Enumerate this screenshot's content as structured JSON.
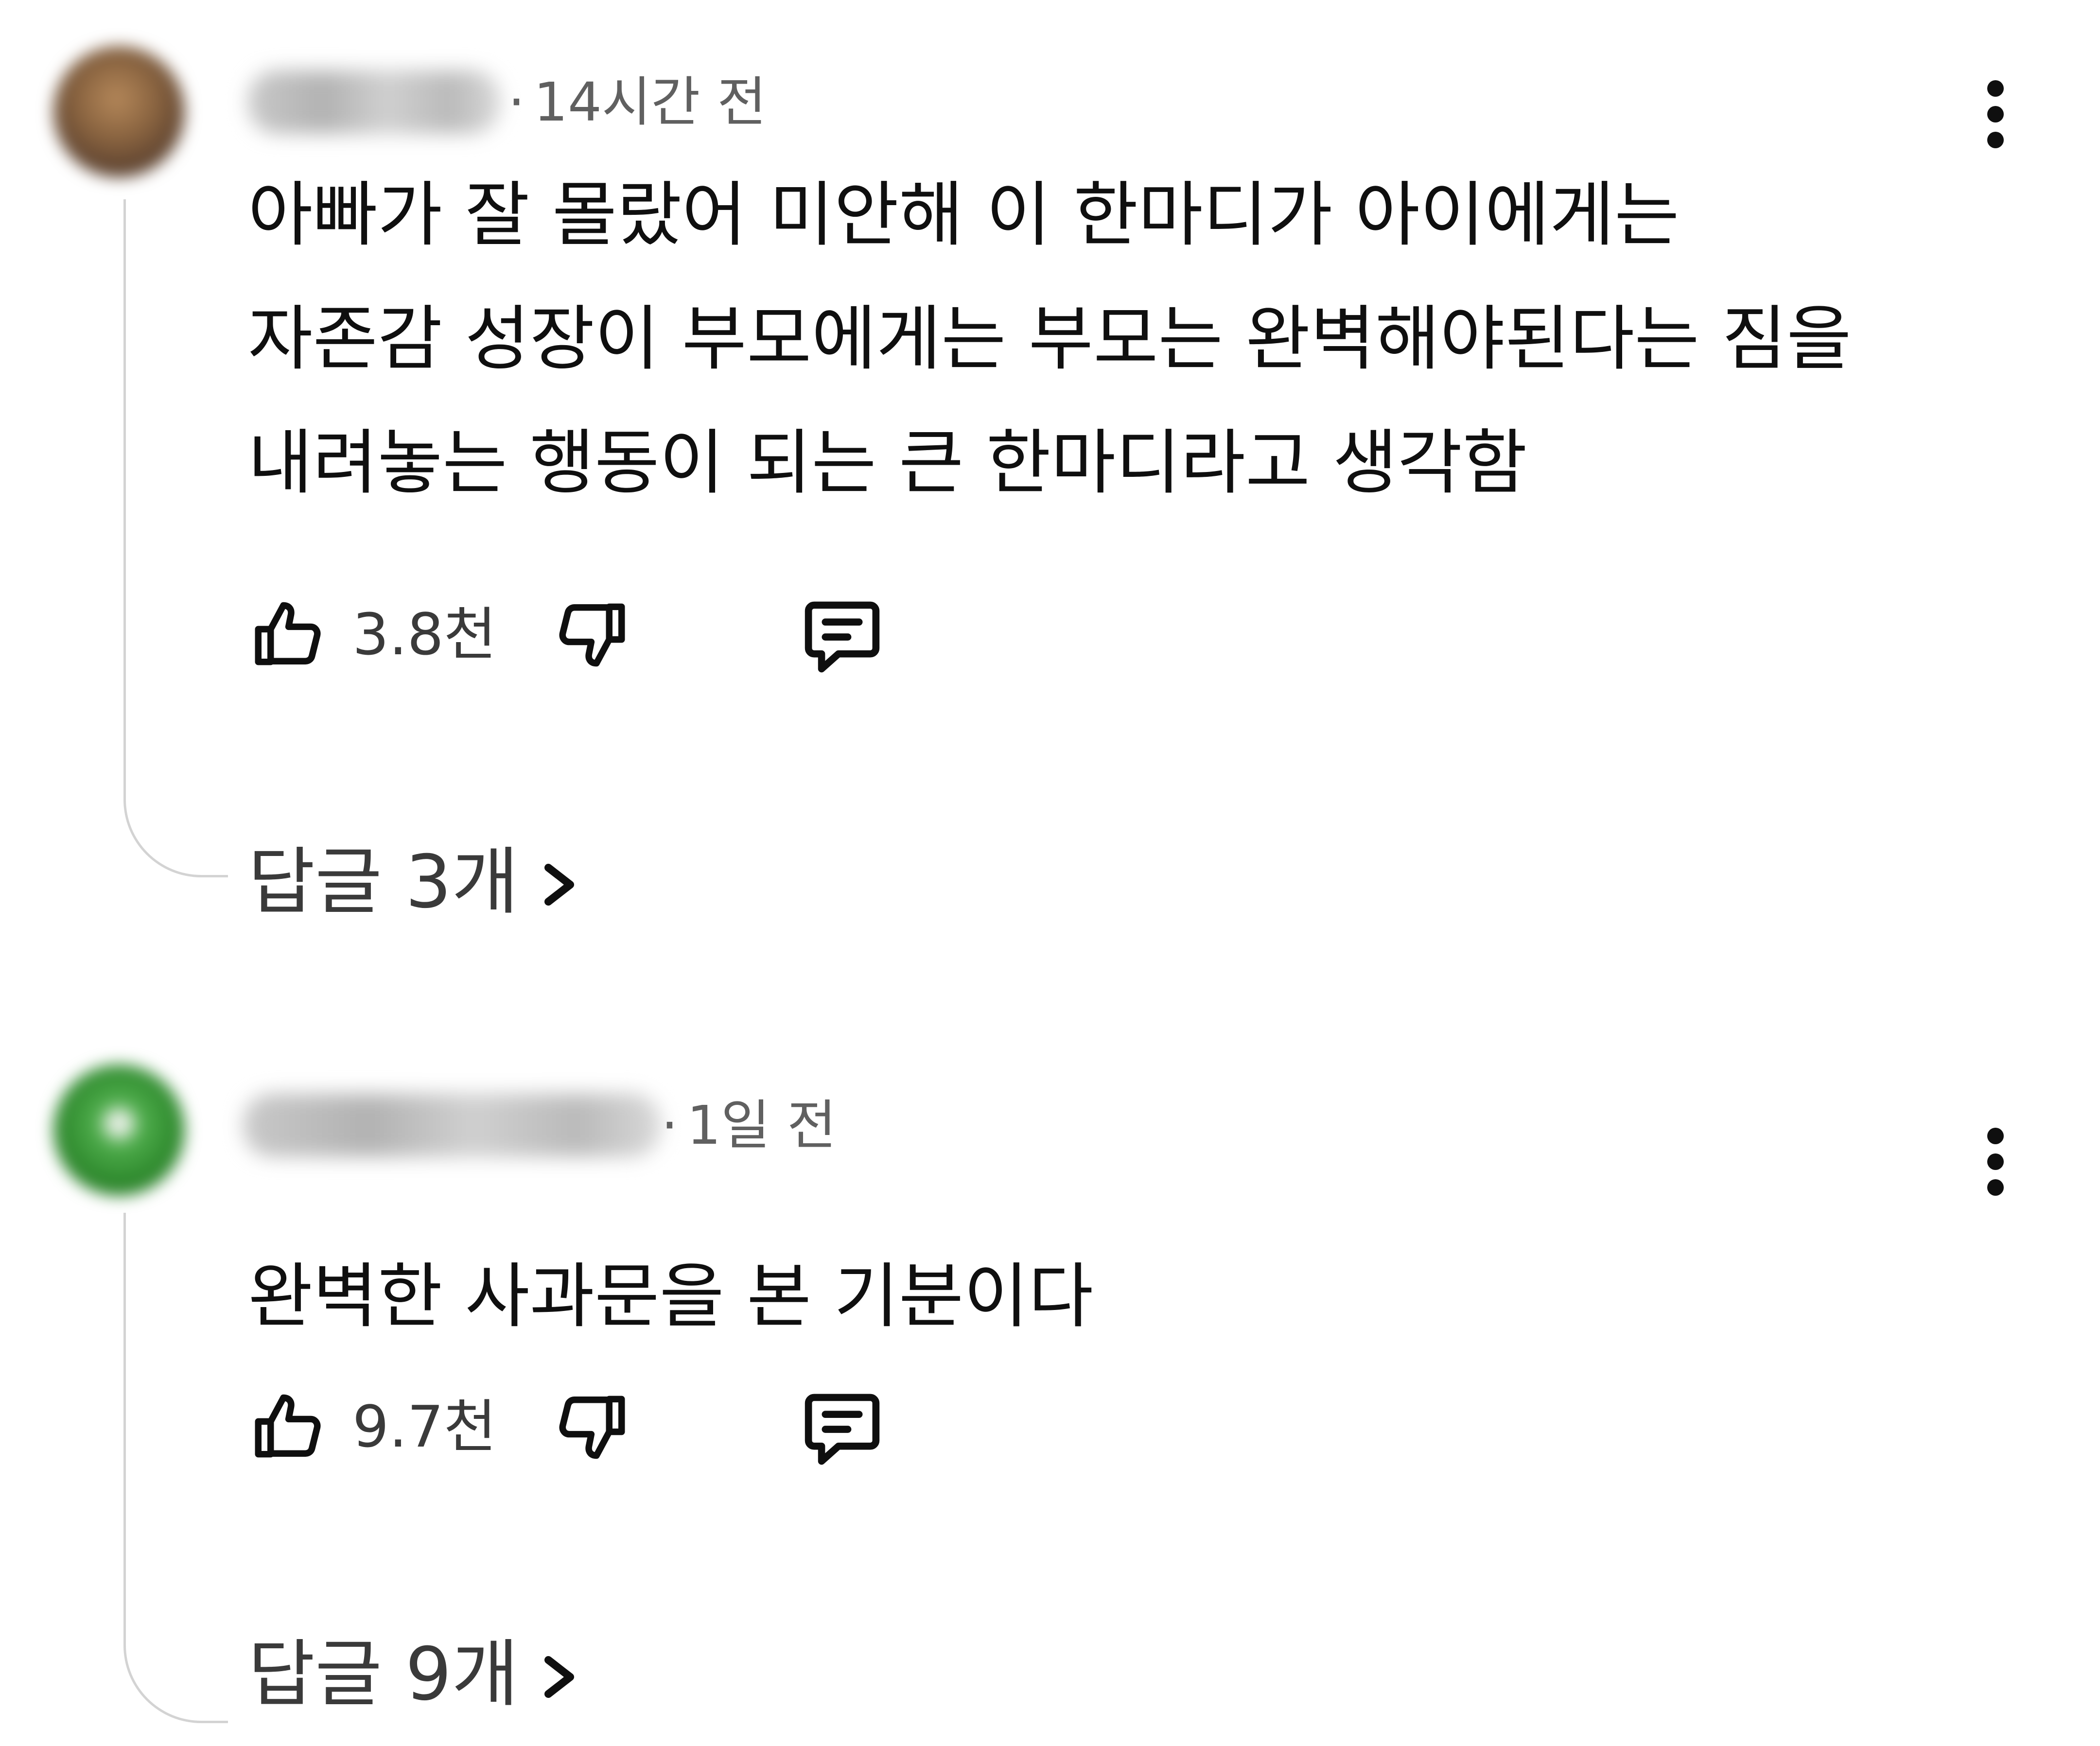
{
  "comments": [
    {
      "author": "",
      "time": "14시간 전",
      "text": "아빠가 잘 몰랐어 미안해 이 한마디가 아이에게는\n자존감 성장이 부모에게는 부모는 완벽해야된다는 짐을\n내려놓는 행동이 되는 큰 한마디라고 생각함",
      "likes": "3.8천",
      "replies": "답글 3개"
    },
    {
      "author": "",
      "time": "1일 전",
      "text": "완벽한 사과문을 본 기분이다",
      "likes": "9.7천",
      "replies": "답글 9개"
    }
  ],
  "meta_separator": "·",
  "icons": {
    "like": "thumb-up-icon",
    "dislike": "thumb-down-icon",
    "reply": "comment-icon",
    "more": "more-vert-icon",
    "expand": "chevron-right-icon"
  },
  "colors": {
    "text": "#0f0f0f",
    "secondary": "#606060",
    "thread_line": "#d3d3d3"
  }
}
